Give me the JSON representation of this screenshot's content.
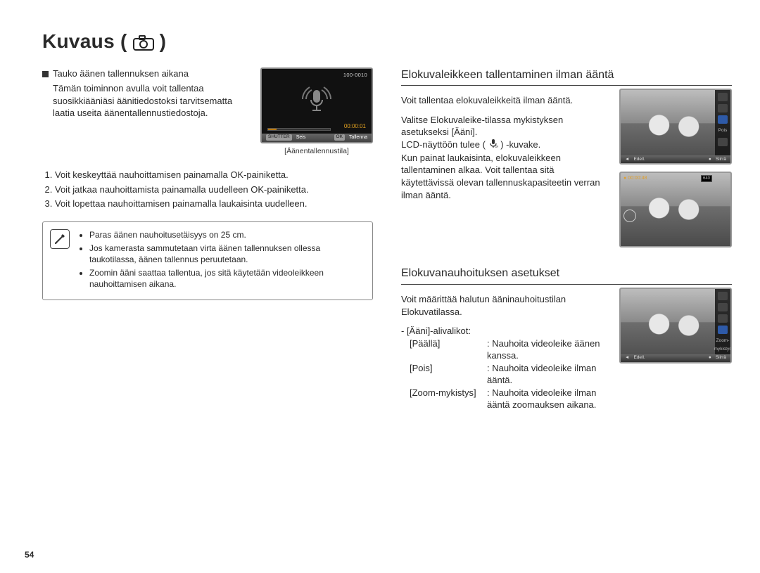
{
  "page_number": "54",
  "title": "Kuvaus (",
  "title_close": ")",
  "left": {
    "bullet_heading": "Tauko äänen tallennuksen aikana",
    "intro": "Tämän toiminnon avulla voit tallentaa suosikkiääniäsi äänitiedostoksi tarvitsematta laatia useita äänentallennustiedostoja.",
    "fig1": {
      "caption": "[Äänentallennustila]",
      "top_right": "100-0010",
      "timer": "00:00:01",
      "btn_shutter": "SHUTTER",
      "btn_ok": "OK",
      "label_stop": "Seis",
      "label_save": "Tallenna"
    },
    "steps": [
      "Voit keskeyttää nauhoittamisen painamalla OK-painiketta.",
      "Voit jatkaa nauhoittamista painamalla uudelleen OK-painiketta.",
      "Voit lopettaa nauhoittamisen painamalla laukaisinta uudelleen."
    ],
    "notes": [
      "Paras äänen nauhoitusetäisyys on 25 cm.",
      "Jos kamerasta sammutetaan virta äänen tallennuksen ollessa taukotilassa, äänen tallennus peruutetaan.",
      "Zoomin ääni saattaa tallentua, jos sitä käytetään videoleikkeen nauhoittamisen aikana."
    ]
  },
  "right": {
    "section1_title": "Elokuvaleikkeen tallentaminen ilman ääntä",
    "section1_lead": "Voit tallentaa elokuvaleikkeitä ilman ääntä.",
    "section1_body_a": "Valitse Elokuvaleike-tilassa mykistyksen asetukseksi [Ääni].",
    "section1_body_b_prefix": "LCD-näyttöön tulee (",
    "section1_body_b_suffix": ") -kuvake.",
    "section1_body_c": "Kun painat laukaisinta, elokuvaleikkeen tallentaminen alkaa. Voit tallentaa sitä käytettävissä olevan tallennuskapasiteetin verran ilman ääntä.",
    "fig_top": {
      "sidebar_label": "Pois",
      "menu_left": "Edell.",
      "menu_right": "Siirrä"
    },
    "fig_bottom_osd": "00:00:48",
    "fig_bottom_res": "640",
    "section2_title": "Elokuvanauhoituksen asetukset",
    "section2_lead": "Voit määrittää halutun ääninauhoitustilan Elokuvatilassa.",
    "submenu_label": "- [Ääni]-alivalikot:",
    "submenu": [
      {
        "key": "[Päällä]",
        "val": ": Nauhoita videoleike äänen kanssa."
      },
      {
        "key": "[Pois]",
        "val": ": Nauhoita videoleike ilman ääntä."
      },
      {
        "key": "[Zoom-mykistys]",
        "val": ": Nauhoita videoleike ilman ääntä zoomauksen aikana."
      }
    ],
    "fig_settings": {
      "sidebar_label": "Zoom-mykistys",
      "menu_left": "Edell.",
      "menu_right": "Siirrä"
    }
  }
}
